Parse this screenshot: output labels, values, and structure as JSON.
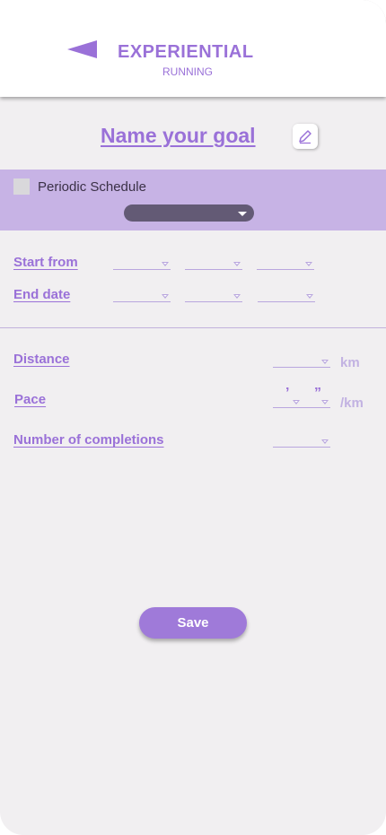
{
  "header": {
    "title": "EXPERIENTIAL",
    "subtitle": "RUNNING",
    "back_icon": "back-triangle-icon"
  },
  "goal": {
    "title": "Name your goal",
    "edit_icon": "pencil-icon"
  },
  "schedule": {
    "checkbox_label": "Periodic Schedule",
    "checked": false,
    "select_value": ""
  },
  "dates": {
    "start_label": "Start from",
    "end_label": "End date"
  },
  "metrics": {
    "distance_label": "Distance",
    "distance_unit": "km",
    "pace_label": "Pace",
    "pace_minute_mark": "’",
    "pace_second_mark": "”",
    "pace_unit": "/km",
    "completions_label": "Number of completions"
  },
  "actions": {
    "save_label": "Save"
  },
  "colors": {
    "accent": "#9a71d8",
    "band": "#c7b3e5",
    "background": "#f1eff1",
    "pill": "#635a75"
  }
}
